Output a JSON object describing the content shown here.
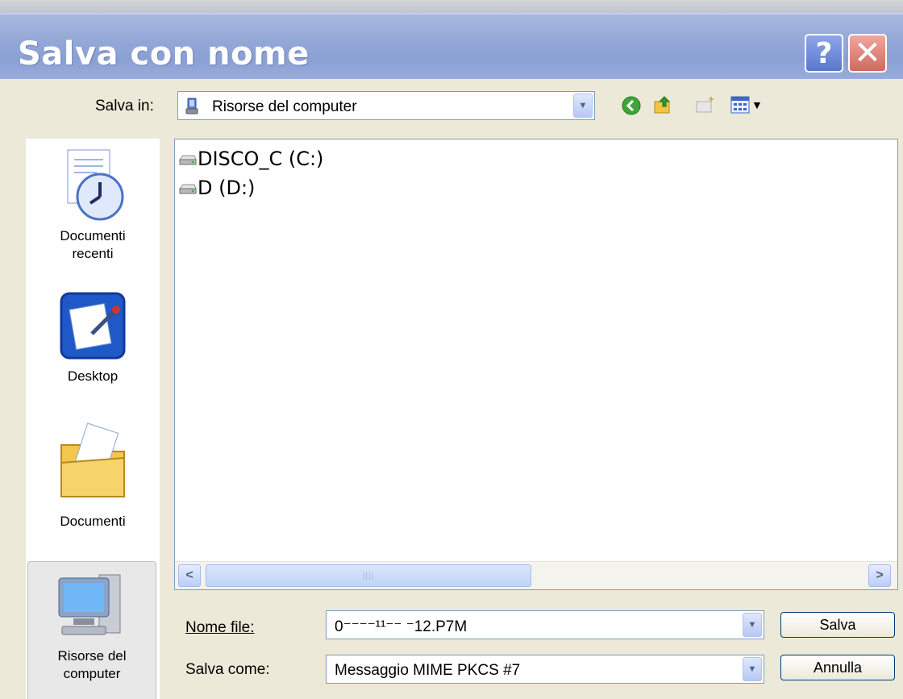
{
  "dialog": {
    "title": "Salva con nome",
    "help_label": "?",
    "close_label": "✕"
  },
  "toolbar": {
    "save_in_label": "Salva in:",
    "location": "Risorse del computer",
    "icons": [
      "back-icon",
      "up-folder-icon",
      "new-folder-icon",
      "view-menu-icon"
    ]
  },
  "places": [
    {
      "label": "Documenti recenti",
      "icon": "recent-documents-icon"
    },
    {
      "label": "Desktop",
      "icon": "desktop-icon"
    },
    {
      "label": "Documenti",
      "icon": "documents-folder-icon"
    },
    {
      "label": "Risorse del computer",
      "icon": "my-computer-icon",
      "selected": true
    }
  ],
  "files": [
    {
      "name": "DISCO_C (C:)",
      "icon": "drive-icon"
    },
    {
      "name": "D (D:)",
      "icon": "drive-icon"
    }
  ],
  "filename": {
    "label": "Nome file:",
    "value": "0⁻⁻⁻⁻¹¹⁻⁻ ⁻12.P7M"
  },
  "filetype": {
    "label": "Salva come:",
    "value": "Messaggio MIME PKCS #7"
  },
  "buttons": {
    "save": "Salva",
    "cancel": "Annulla"
  },
  "scrollbar": {
    "left_arrow": "<",
    "right_arrow": ">",
    "thumb_grip": "||||"
  }
}
